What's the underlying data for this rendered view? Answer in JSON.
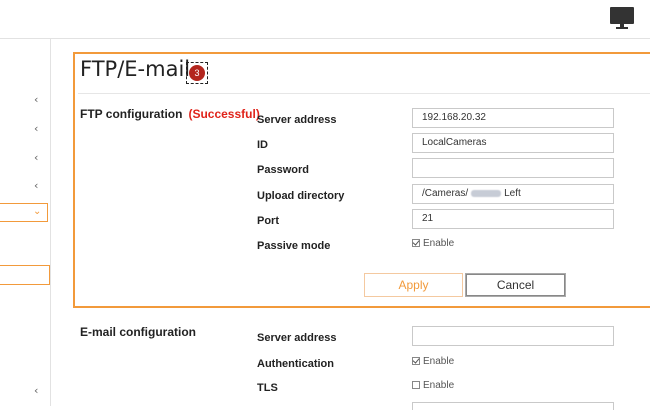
{
  "header": {
    "monitor_icon": "monitor-icon"
  },
  "sidebar": {
    "chevrons": [
      "‹",
      "‹",
      "‹",
      "‹",
      "‹"
    ],
    "expanded_chevron": "⌄"
  },
  "page": {
    "title": "FTP/E-mail",
    "badge": "3"
  },
  "ftp": {
    "section_label": "FTP configuration",
    "status": "(Successful)",
    "fields": {
      "server_address_label": "Server address",
      "server_address_value": "192.168.20.32",
      "id_label": "ID",
      "id_value": "LocalCameras",
      "password_label": "Password",
      "password_value": "",
      "upload_dir_label": "Upload directory",
      "upload_dir_prefix": "/Cameras/",
      "upload_dir_suffix": "Left",
      "port_label": "Port",
      "port_value": "21",
      "passive_label": "Passive mode",
      "passive_enable": "Enable"
    },
    "apply_label": "Apply",
    "cancel_label": "Cancel"
  },
  "email": {
    "section_label": "E-mail configuration",
    "server_address_label": "Server address",
    "server_address_value": "",
    "authentication_label": "Authentication",
    "authentication_enable": "Enable",
    "tls_label": "TLS",
    "tls_enable": "Enable"
  },
  "colors": {
    "accent": "#f29a3b",
    "status_ok": "#e0241b",
    "badge": "#b3261e"
  }
}
